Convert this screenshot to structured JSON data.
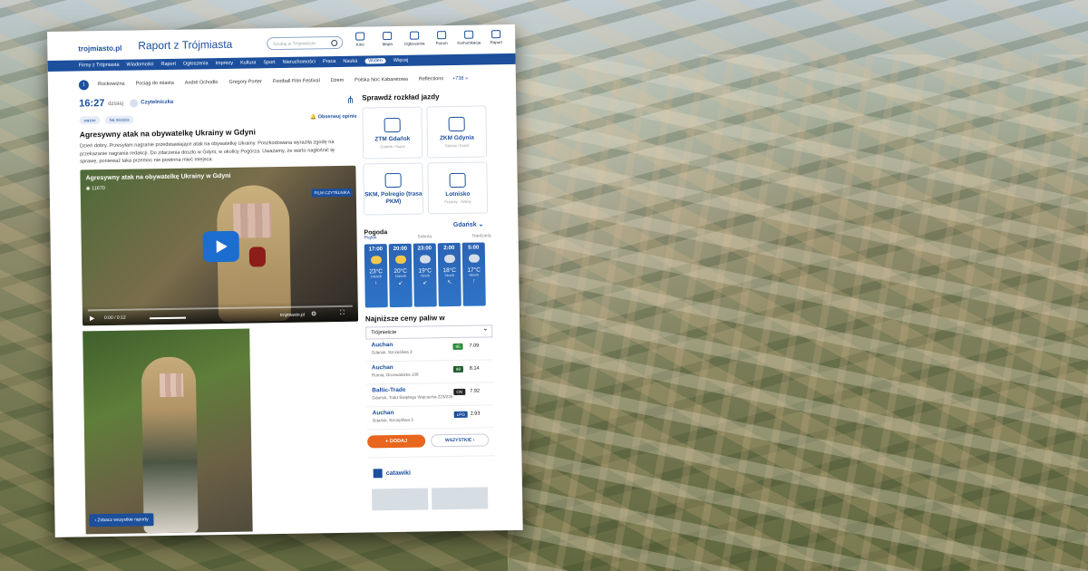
{
  "site": {
    "logo": "trojmiasto",
    "logo_suffix": ".pl",
    "section_title": "Raport z Trójmiasta",
    "search_placeholder": "Szukaj w Trójmieście"
  },
  "tools": [
    {
      "label": "Kino",
      "icon": "film-icon"
    },
    {
      "label": "Mapa",
      "icon": "map-icon"
    },
    {
      "label": "Ogłoszenia",
      "icon": "ads-icon"
    },
    {
      "label": "Forum",
      "icon": "forum-icon"
    },
    {
      "label": "Komunikacja",
      "icon": "bus-icon"
    },
    {
      "label": "Raport",
      "icon": "report-icon"
    }
  ],
  "nav": [
    "Firmy z Trójmiasta",
    "Wiadomości",
    "Raport",
    "Ogłoszenia",
    "Imprezy",
    "Kultura",
    "Sport",
    "Nieruchomości",
    "Praca",
    "Nauka",
    "Wideo",
    "Więcej"
  ],
  "nav_active": "Wideo",
  "subnav": {
    "dot": "1",
    "items": [
      "Rockowizna",
      "Pociąg do miasta",
      "André Ochodlo",
      "Gregory Porter",
      "Football Film Festival",
      "Dżem",
      "Polska Noc Kabaretowa",
      "Reflections"
    ],
    "more": "+738 »"
  },
  "report": {
    "time": "16:27",
    "day": "dzisiaj",
    "author": "Czytelniczka",
    "tags": [
      "ważne",
      "Na mieście"
    ],
    "follow": "Obserwuj opinie",
    "headline": "Agresywny atak na obywatelkę Ukrainy w Gdyni",
    "text": "Dzień dobry. Przesyłam nagranie przedstawiające atak na obywatelkę Ukrainy. Poszkodowana wyraziła zgodę na przekazanie nagrania redakcji. Do zdarzenia doszło w Gdyni, w okolicy Pogórza. Uważamy, że warto nagłośnić tę sprawę, ponieważ taka przemoc nie powinna mieć miejsca."
  },
  "video": {
    "title": "Agresywny atak na obywatelkę Ukrainy w Gdyni",
    "views": "11670",
    "badge": "FILM CZYTELNIKA",
    "time": "0:00 / 0:12",
    "brand": "trojmiasto.pl"
  },
  "see_all": "Zobacz wszystkie raporty",
  "transport": {
    "heading": "Sprawdź rozkład jazdy",
    "cards": [
      {
        "name": "ZTM Gdańsk",
        "sub": "Gdańsk i Sopot"
      },
      {
        "name": "ZKM Gdynia",
        "sub": "Gdynia i Sopot"
      },
      {
        "name": "SKM, Polregio (trasa PKM)",
        "sub": ""
      },
      {
        "name": "Lotnisko",
        "sub": "Przyloty · Odloty"
      }
    ]
  },
  "weather": {
    "title": "Pogoda",
    "city": "Gdańsk",
    "days": [
      "Piątek",
      "Sobota",
      "Niedziela"
    ],
    "hours": [
      {
        "h": "17:00",
        "t": "23°C",
        "w": "14km/h",
        "a": "↓",
        "sun": true
      },
      {
        "h": "20:00",
        "t": "20°C",
        "w": "11km/h",
        "a": "↙",
        "sun": true
      },
      {
        "h": "23:00",
        "t": "19°C",
        "w": "7km/h",
        "a": "↙",
        "sun": false
      },
      {
        "h": "2:00",
        "t": "18°C",
        "w": "5km/h",
        "a": "↖",
        "sun": false
      },
      {
        "h": "5:00",
        "t": "17°C",
        "w": "6km/h",
        "a": "↑",
        "sun": false
      }
    ]
  },
  "fuel": {
    "title": "Najniższe ceny paliw w",
    "region": "Trójmieście",
    "rows": [
      {
        "name": "Auchan",
        "addr": "Gdańsk, Szczęśliwa 3",
        "type": "95",
        "price": "7.09",
        "color": "#2e8b3a"
      },
      {
        "name": "Auchan",
        "addr": "Rumia, Grunwaldzka 108",
        "type": "98",
        "price": "8.14",
        "color": "#1f5e2b"
      },
      {
        "name": "Baltic-Trade",
        "addr": "Gdańsk, Trakt Świętego Wojciecha 223/225",
        "type": "ON",
        "price": "7.92",
        "color": "#222222"
      },
      {
        "name": "Auchan",
        "addr": "Gdańsk, Szczęśliwa 3",
        "type": "LPG",
        "price": "2.93",
        "color": "#1c4f9c"
      }
    ],
    "add_label": "+ DODAJ",
    "all_label": "WSZYSTKIE ›"
  },
  "ad": {
    "brand": "catawiki"
  }
}
